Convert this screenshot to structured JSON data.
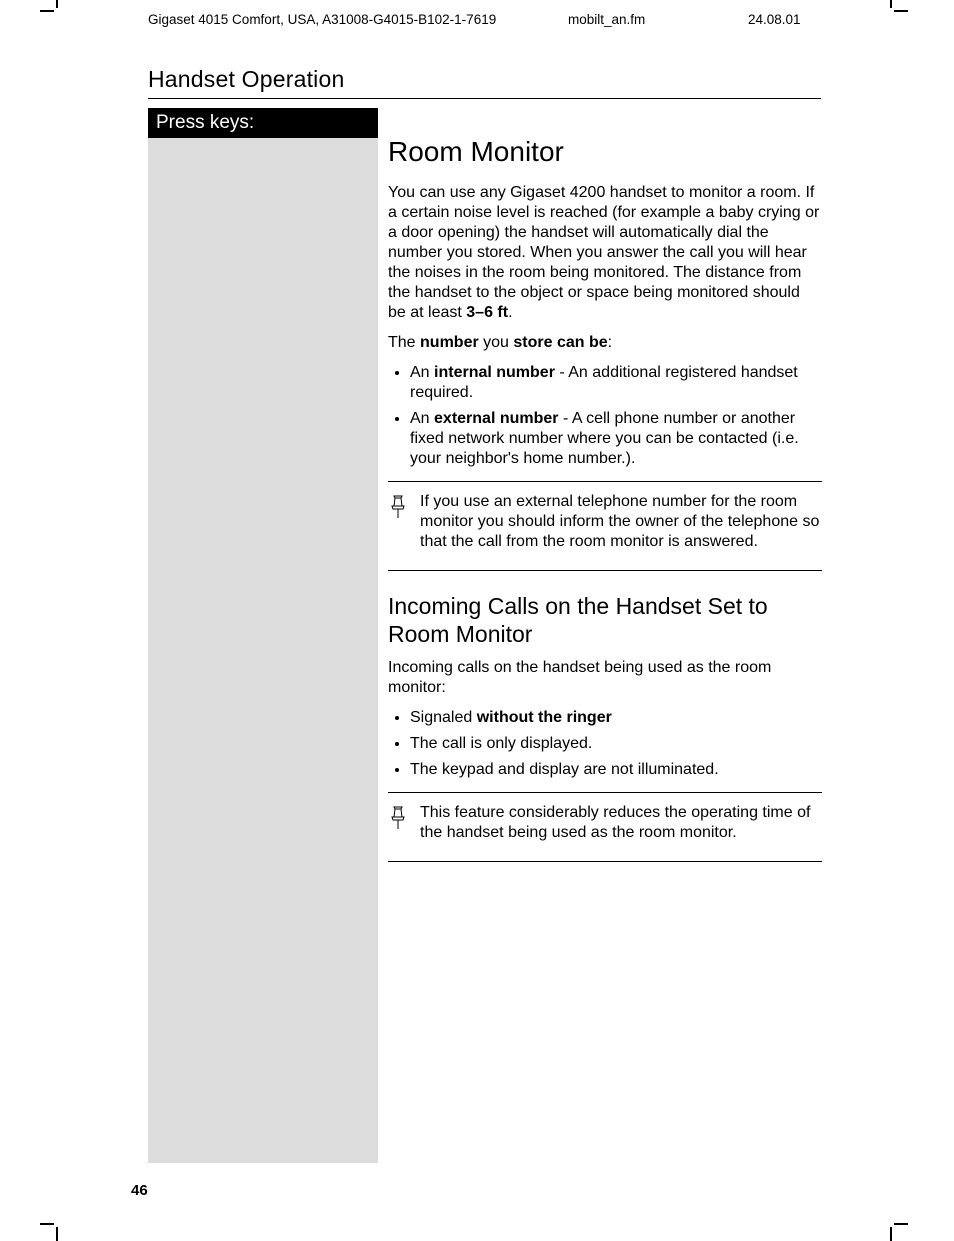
{
  "header": {
    "left": "Gigaset 4015 Comfort, USA, A31008-G4015-B102-1-7619",
    "mid": "mobilt_an.fm",
    "right": "24.08.01"
  },
  "section_title": "Handset Operation",
  "sidebar": {
    "header": "Press keys:"
  },
  "main": {
    "h1": "Room Monitor",
    "p1_a": "You can use any Gigaset 4200 handset to monitor a room.   If a certain noise level is reached (for example a baby crying or a door opening) the handset will automatically dial the number you stored.  When you answer the call you will hear the noises in the room being monitored.  The distance from the handset to the object or space being monitored should be at least ",
    "p1_bold": "3–6 ft",
    "p1_c": ".",
    "p2_a": "The ",
    "p2_b": "number",
    "p2_c": " you ",
    "p2_d": "store can be",
    "p2_e": ":",
    "bullets1": [
      {
        "lead": "An ",
        "bold": "internal number",
        "rest": " - An additional registered handset required."
      },
      {
        "lead": "An ",
        "bold": "external number",
        "rest": " - A cell phone number or another fixed network number where you can be contacted (i.e. your neighbor's home number.)."
      }
    ],
    "note1": "If you use an external telephone number for the room monitor you should inform the owner of the telephone so that the call from the room monitor is answered.",
    "h2": "Incoming Calls on the Handset Set to Room Monitor",
    "p3": "Incoming calls on the handset being used as the room monitor:",
    "bullets2": [
      {
        "lead": "Signaled ",
        "bold": "without the ringer",
        "rest": ""
      },
      {
        "lead": "The call is only displayed.",
        "bold": "",
        "rest": ""
      },
      {
        "lead": "The keypad and display are not illuminated.",
        "bold": "",
        "rest": ""
      }
    ],
    "note2": "This feature considerably reduces the operating time of the handset being used as the room monitor."
  },
  "page_number": "46"
}
